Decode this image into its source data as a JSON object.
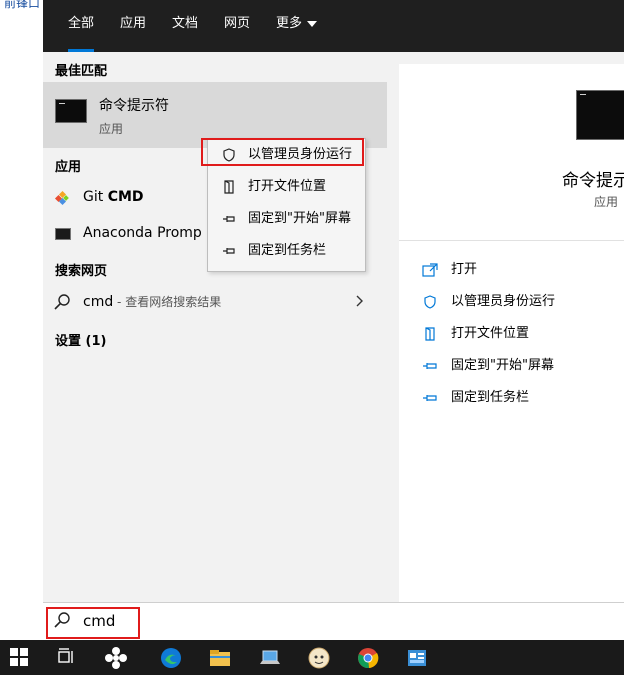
{
  "background_window": {
    "text": "前锋口"
  },
  "tabs": [
    {
      "label": "全部",
      "active": true
    },
    {
      "label": "应用"
    },
    {
      "label": "文档"
    },
    {
      "label": "网页"
    },
    {
      "label": "更多"
    }
  ],
  "sections": {
    "best_match": "最佳匹配",
    "apps": "应用",
    "web": "搜索网页",
    "settings": "设置 (1)"
  },
  "best_match": {
    "title": "命令提示符",
    "subtitle": "应用"
  },
  "apps": [
    {
      "prefix": "Git ",
      "bold": "CMD",
      "icon": "git-icon"
    },
    {
      "prefix": "Anaconda Promp",
      "bold": "",
      "icon": "terminal-icon"
    }
  ],
  "web_search": {
    "query": "cmd",
    "suffix": " - 查看网络搜索结果"
  },
  "context_menu": [
    {
      "label": "以管理员身份运行",
      "icon": "shield-icon"
    },
    {
      "label": "打开文件位置",
      "icon": "folder-open-icon"
    },
    {
      "label": "固定到\"开始\"屏幕",
      "icon": "pin-icon"
    },
    {
      "label": "固定到任务栏",
      "icon": "pin-icon"
    }
  ],
  "preview": {
    "title": "命令提示",
    "subtitle": "应用"
  },
  "preview_actions": [
    {
      "label": "打开",
      "icon": "open-icon"
    },
    {
      "label": "以管理员身份运行",
      "icon": "shield-icon"
    },
    {
      "label": "打开文件位置",
      "icon": "folder-open-icon"
    },
    {
      "label": "固定到\"开始\"屏幕",
      "icon": "pin-icon"
    },
    {
      "label": "固定到任务栏",
      "icon": "pin-icon"
    }
  ],
  "search": {
    "value": "cmd"
  },
  "taskbar": [
    "windows-start-icon",
    "task-view-icon",
    "fan-app-icon",
    "edge-icon",
    "file-explorer-icon",
    "laptop-app-icon",
    "avatar-app-icon",
    "chrome-icon",
    "control-panel-icon"
  ],
  "colors": {
    "accent": "#0078d7",
    "highlight_box": "#e01b1b",
    "topbar": "#1f1f1f",
    "taskbar": "#1a1a1a"
  }
}
